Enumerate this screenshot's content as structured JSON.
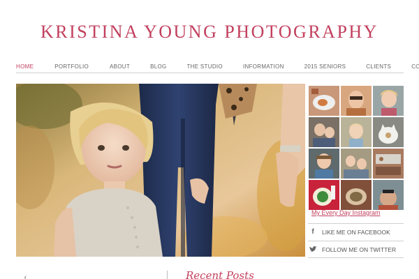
{
  "site": {
    "title": "KRISTINA YOUNG PHOTOGRAPHY",
    "accent_color": "#c2405e"
  },
  "nav": {
    "items": [
      {
        "label": "HOME",
        "active": true
      },
      {
        "label": "PORTFOLIO",
        "active": false
      },
      {
        "label": "ABOUT",
        "active": false
      },
      {
        "label": "BLOG",
        "active": false
      },
      {
        "label": "THE STUDIO",
        "active": false
      },
      {
        "label": "INFORMATION",
        "active": false
      },
      {
        "label": "2015 SENIORS",
        "active": false
      },
      {
        "label": "CLIENTS",
        "active": false
      },
      {
        "label": "CONTACT",
        "active": false
      }
    ]
  },
  "sidebar": {
    "instagram_link": "My Every Day Instagram",
    "facebook_label": "LIKE ME ON FACEBOOK",
    "facebook_icon": "facebook-icon",
    "twitter_label": "FOLLOW ME ON TWITTER",
    "twitter_icon": "twitter-icon"
  },
  "bottom": {
    "left_glyph": "‹",
    "script_heading": "Recent Posts"
  }
}
